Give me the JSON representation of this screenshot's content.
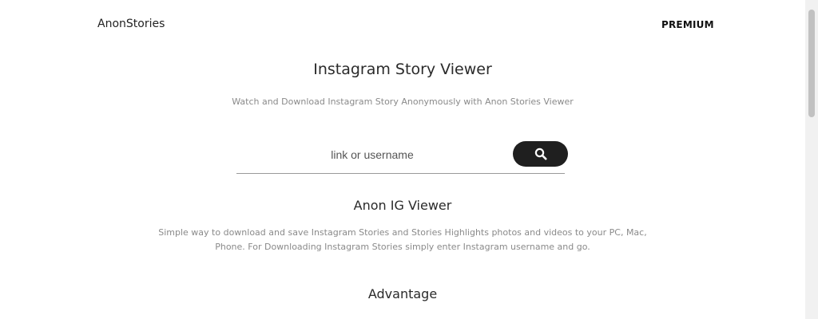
{
  "header": {
    "logo": "AnonStories",
    "premium": "PREMIUM"
  },
  "hero": {
    "title": "Instagram Story Viewer",
    "subtitle": "Watch and Download Instagram Story Anonymously with Anon Stories Viewer"
  },
  "search": {
    "placeholder": "link or username",
    "value": ""
  },
  "sections": [
    {
      "title": "Anon IG Viewer",
      "lines": [
        "Simple way to download and save Instagram Stories and Stories Highlights photos and videos to your PC, Mac,",
        "Phone. For Downloading Instagram Stories simply enter Instagram username and go."
      ]
    },
    {
      "title": "Advantage"
    }
  ],
  "colors": {
    "button": "#1f1f1f",
    "muted_text": "#8a8a8a"
  }
}
